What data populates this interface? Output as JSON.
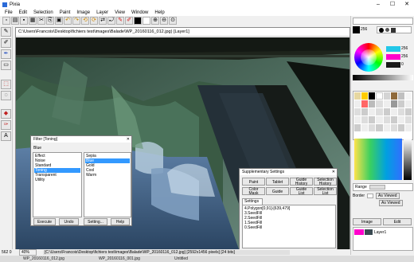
{
  "app": {
    "title": "Pixia"
  },
  "menu": [
    "File",
    "Edit",
    "Selection",
    "Paint",
    "Image",
    "Layer",
    "View",
    "Window",
    "Help"
  ],
  "document": {
    "title": "C:\\Users\\Francois\\Desktop\\fichiers test\\images\\Balade\\WP_20160116_012.jpg) [Layer1]"
  },
  "filter": {
    "title": "Filter [Toning]",
    "current": "Blue",
    "effects": [
      "Effect",
      "Noise",
      "Standard",
      "Toning",
      "Transparent",
      "Utility"
    ],
    "effect_selected": 3,
    "tones": [
      "Sepia",
      "Blue",
      "Gold",
      "Cool",
      "Warm"
    ],
    "tone_selected": 1,
    "buttons": [
      "Execute",
      "Undo",
      "Setting...",
      "Help"
    ]
  },
  "supp": {
    "title": "Supplementary Settings",
    "buttons_row1": [
      "Paint",
      "Tablet",
      "Guide\nHistory",
      "Selection\nHistory"
    ],
    "buttons_row2": [
      "Color\nMask",
      "Guide",
      "Guide\nList",
      "Selection\nList"
    ],
    "settings_tab": "Settings",
    "history": [
      "4.Polygon[0,91]-[639,479]",
      "3.SeedFill",
      "2.SeedFill",
      "1.SeedFill",
      "0.SeedFill"
    ]
  },
  "panel": {
    "size_value": "256",
    "values": [
      "256",
      "256",
      "0"
    ],
    "range_label": "Range",
    "border_label": "Border",
    "as_viewed": "As Viewed",
    "tabs": [
      "Image",
      "Edit"
    ],
    "layer_name": "Layer1"
  },
  "status": {
    "zoom": "562 0",
    "ratio": "40%",
    "path": "[C:\\Users\\Francois\\Desktop\\fichiers test\\images\\Balade\\WP_20160116_012.jpg] [2592x1456 pixels] [24 bits]"
  },
  "taskbar": [
    "WP_20160116_012.jpg",
    "WP_20160116_001.jpg",
    "Untitled"
  ],
  "colors": {
    "accent": "#3399ff",
    "swatch_black": "#000000",
    "swatch_white": "#ffffff",
    "fg": "#ff00cc",
    "bg": "#22c7e8"
  }
}
